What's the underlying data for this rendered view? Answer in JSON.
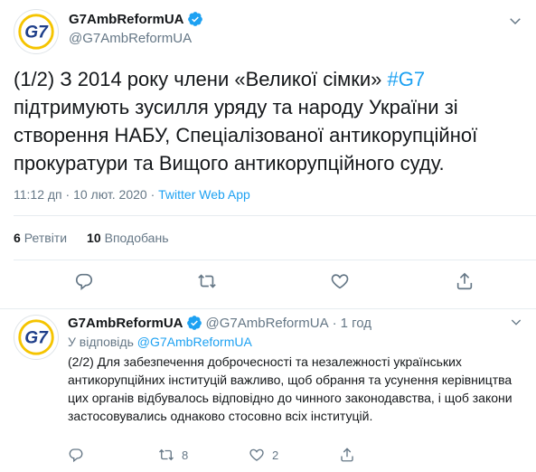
{
  "main_tweet": {
    "display_name": "G7AmbReformUA",
    "handle": "@G7AmbReformUA",
    "text_prefix": "(1/2) З 2014 року члени «Великої сімки» ",
    "hashtag": "#G7",
    "text_suffix": " підтримують зусилля уряду та народу України зі створення НАБУ, Спеціалізованої антикорупційної прокуратури та Вищого антикорупційного суду.",
    "time": "11:12 дп · 10 лют. 2020",
    "separator": " · ",
    "source": "Twitter Web App",
    "retweets_count": "6",
    "retweets_label": "Ретвіти",
    "likes_count": "10",
    "likes_label": "Вподобань"
  },
  "reply_tweet": {
    "display_name": "G7AmbReformUA",
    "handle": "@G7AmbReformUA",
    "dot": "·",
    "time_ago": "1 год",
    "reply_to_prefix": "У відповідь ",
    "reply_to_handle": "@G7AmbReformUA",
    "text": "(2/2) Для забезпечення доброчесності та незалежності українських антикорупційних інституцій важливо, щоб обрання та усунення керівництва цих органів відбувалось відповідно до чинного законодавства, і щоб закони застосовувались однаково стосовно всіх інституцій.",
    "retweet_count": "8",
    "like_count": "2"
  },
  "avatar_logo_text": "G7",
  "colors": {
    "accent": "#1da1f2",
    "secondary_text": "#657786",
    "logo_blue": "#1f3f8a",
    "logo_yellow": "#f5c400"
  },
  "icons": [
    "verified-badge-icon",
    "chevron-down-icon",
    "reply-icon",
    "retweet-icon",
    "like-icon",
    "share-icon"
  ]
}
